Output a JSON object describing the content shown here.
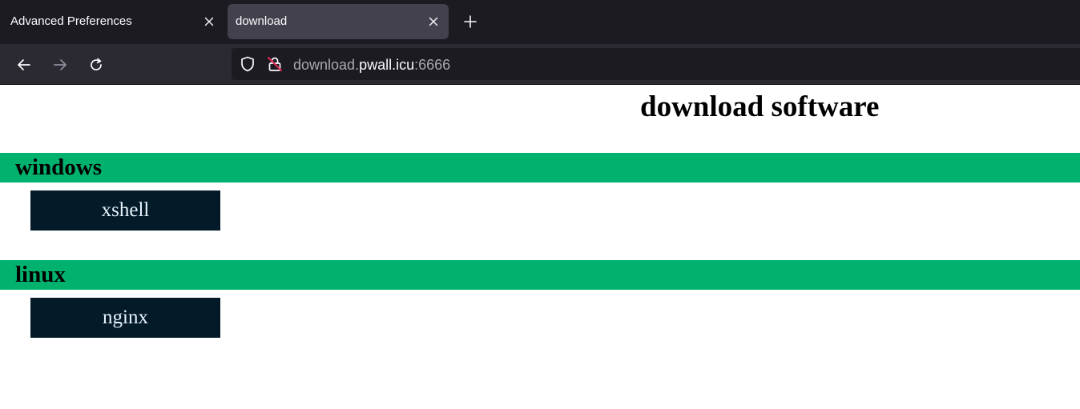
{
  "browser": {
    "tabs": [
      {
        "title": "Advanced Preferences",
        "active": false,
        "close_icon": "close-icon"
      },
      {
        "title": "download",
        "active": true,
        "close_icon": "close-icon"
      }
    ],
    "new_tab_icon": "plus-icon",
    "nav": {
      "back_icon": "back-arrow-icon",
      "forward_icon": "forward-arrow-icon",
      "reload_icon": "reload-icon"
    },
    "urlbar": {
      "shield_icon": "tracking-protection-shield-icon",
      "lock_icon": "insecure-lock-icon",
      "url_prefix": "download.",
      "url_host": "pwall.icu",
      "url_suffix": ":6666"
    },
    "colors": {
      "tabstrip_bg": "#1c1b22",
      "active_tab_bg": "#42414d",
      "navbar_bg": "#2b2a33",
      "insecure_accent": "#e22850"
    }
  },
  "page": {
    "title": "download software",
    "sections": [
      {
        "heading": "windows",
        "items": [
          "xshell"
        ]
      },
      {
        "heading": "linux",
        "items": [
          "nginx"
        ]
      }
    ],
    "colors": {
      "section_bar": "#00b26e",
      "button_bg": "#031a29",
      "button_text": "#e8f4fb"
    }
  }
}
